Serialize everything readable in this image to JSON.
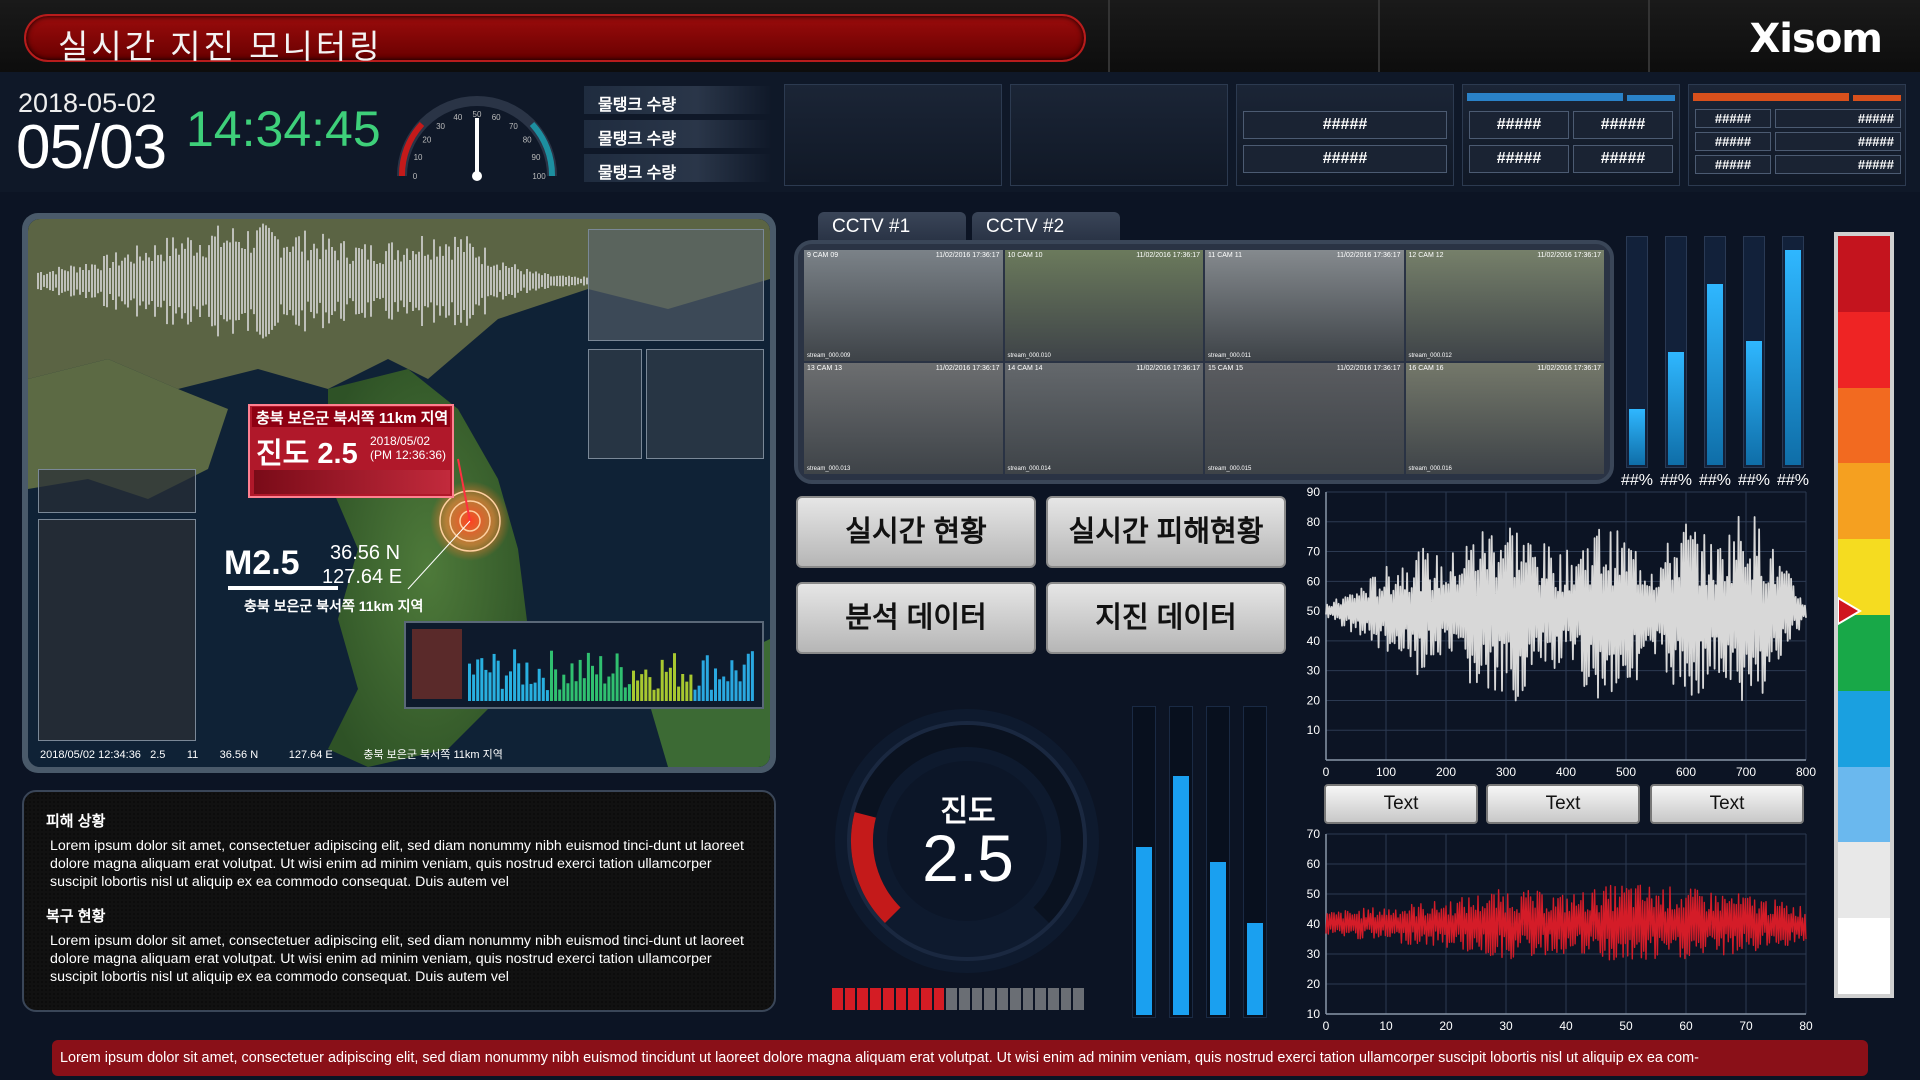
{
  "header": {
    "title": "실시간 지진 모니터링",
    "logo": "Xisom"
  },
  "datetime": {
    "date": "2018-05-02",
    "month_day": "05/03",
    "time": "14:34:45"
  },
  "speedometer": {
    "ticks": [
      "0",
      "10",
      "20",
      "30",
      "40",
      "50",
      "60",
      "70",
      "80",
      "90",
      "100"
    ],
    "needle": 50
  },
  "tanks": [
    "물탱크 수량",
    "물탱크 수량",
    "물탱크 수량"
  ],
  "panels": {
    "p3": [
      "#####",
      "#####"
    ],
    "p4": [
      "#####",
      "#####",
      "#####",
      "#####"
    ],
    "p5": [
      "#####",
      "#####",
      "#####",
      "#####",
      "#####",
      "#####"
    ]
  },
  "map": {
    "card_location": "충북 보은군 북서쪽 11km 지역",
    "card_intensity": "진도 2.5",
    "card_date": "2018/05/02",
    "card_time": "(PM 12:36:36)",
    "magnitude": "M2.5",
    "lat": "36.56 N",
    "lon": "127.64 E",
    "region": "충북 보은군 북서쪽 11km 지역",
    "footer": [
      "2018/05/02 12:34:36",
      "2.5",
      "11",
      "36.56 N",
      "127.64 E",
      "충북 보은군 북서쪽 11km 지역"
    ]
  },
  "damage": {
    "h1": "피해 상황",
    "t1": "Lorem ipsum dolor sit amet, consectetuer adipiscing elit, sed diam nonummy nibh euismod tinci-dunt ut laoreet dolore magna aliquam erat volutpat. Ut wisi enim ad minim veniam, quis nostrud exerci tation ullamcorper suscipit lobortis nisl ut aliquip ex ea commodo consequat. Duis autem vel",
    "h2": "복구 현황",
    "t2": "Lorem ipsum dolor sit amet, consectetuer adipiscing elit, sed diam nonummy nibh euismod tinci-dunt ut laoreet dolore magna aliquam erat volutpat. Ut wisi enim ad minim veniam, quis nostrud exerci tation ullamcorper suscipit lobortis nisl ut aliquip ex ea commodo consequat. Duis autem vel"
  },
  "cctv": {
    "tabs": [
      "CCTV #1",
      "CCTV #2"
    ],
    "cams": [
      {
        "label": "9 CAM 09",
        "ts": "11/02/2016 17:36:17",
        "id": "stream_000.009"
      },
      {
        "label": "10 CAM 10",
        "ts": "11/02/2016 17:36:17",
        "id": "stream_000.010"
      },
      {
        "label": "11 CAM 11",
        "ts": "11/02/2016 17:36:17",
        "id": "stream_000.011"
      },
      {
        "label": "12 CAM 12",
        "ts": "11/02/2016 17:36:17",
        "id": "stream_000.012"
      },
      {
        "label": "13 CAM 13",
        "ts": "11/02/2016 17:36:17",
        "id": "stream_000.013"
      },
      {
        "label": "14 CAM 14",
        "ts": "11/02/2016 17:36:17",
        "id": "stream_000.014"
      },
      {
        "label": "15 CAM 15",
        "ts": "11/02/2016 17:36:17",
        "id": "stream_000.015"
      },
      {
        "label": "16 CAM 16",
        "ts": "11/02/2016 17:36:17",
        "id": "stream_000.016"
      }
    ]
  },
  "buttons": [
    "실시간 현황",
    "실시간 피해현황",
    "분석 데이터",
    "지진 데이터"
  ],
  "levels": {
    "values": [
      0.25,
      0.5,
      0.8,
      0.55,
      0.95
    ],
    "labels": [
      "##%",
      "##%",
      "##%",
      "##%",
      "##%"
    ]
  },
  "gauge": {
    "label": "진도",
    "value": "2.5",
    "fill": 0.22,
    "segments_lit": 9,
    "segments_total": 20
  },
  "vbars": [
    0.55,
    0.78,
    0.5,
    0.3
  ],
  "text_buttons": [
    "Text",
    "Text",
    "Text"
  ],
  "scale_colors": [
    "#c4141e",
    "#ee2424",
    "#f26a20",
    "#f5a020",
    "#f5dc20",
    "#18a848",
    "#1aa0e0",
    "#6ab8ee",
    "#e8e8e8",
    "#ffffff"
  ],
  "ticker": "Lorem ipsum dolor sit amet, consectetuer adipiscing elit, sed diam nonummy nibh euismod tincidunt ut laoreet dolore magna aliquam erat volutpat. Ut wisi enim ad minim veniam, quis nostrud exerci tation ullamcorper suscipit lobortis nisl ut aliquip ex ea com-",
  "chart_data": [
    {
      "type": "line",
      "title": "",
      "x_ticks": [
        0,
        100,
        200,
        300,
        400,
        500,
        600,
        700,
        800
      ],
      "y_ticks": [
        10,
        20,
        30,
        40,
        50,
        60,
        70,
        80,
        90
      ],
      "xlim": [
        0,
        800
      ],
      "ylim": [
        0,
        90
      ],
      "grid": true,
      "series": [
        {
          "color": "#d8d8d8",
          "baseline": 50,
          "amplitude_envelope": [
            [
              0,
              2
            ],
            [
              50,
              8
            ],
            [
              100,
              15
            ],
            [
              150,
              22
            ],
            [
              200,
              18
            ],
            [
              250,
              28
            ],
            [
              300,
              34
            ],
            [
              350,
              24
            ],
            [
              400,
              20
            ],
            [
              450,
              30
            ],
            [
              500,
              26
            ],
            [
              550,
              18
            ],
            [
              600,
              32
            ],
            [
              650,
              22
            ],
            [
              700,
              38
            ],
            [
              750,
              20
            ],
            [
              800,
              3
            ]
          ]
        }
      ]
    },
    {
      "type": "line",
      "title": "",
      "x_ticks": [
        0,
        10,
        20,
        30,
        40,
        50,
        60,
        70,
        80
      ],
      "y_ticks": [
        10,
        20,
        30,
        40,
        50,
        60,
        70
      ],
      "xlim": [
        0,
        80
      ],
      "ylim": [
        10,
        70
      ],
      "grid": true,
      "series": [
        {
          "color": "#d41c28",
          "baseline": 40,
          "amplitude_envelope": [
            [
              0,
              4
            ],
            [
              10,
              6
            ],
            [
              20,
              8
            ],
            [
              30,
              12
            ],
            [
              40,
              10
            ],
            [
              50,
              14
            ],
            [
              60,
              12
            ],
            [
              70,
              10
            ],
            [
              80,
              6
            ]
          ]
        }
      ]
    }
  ]
}
